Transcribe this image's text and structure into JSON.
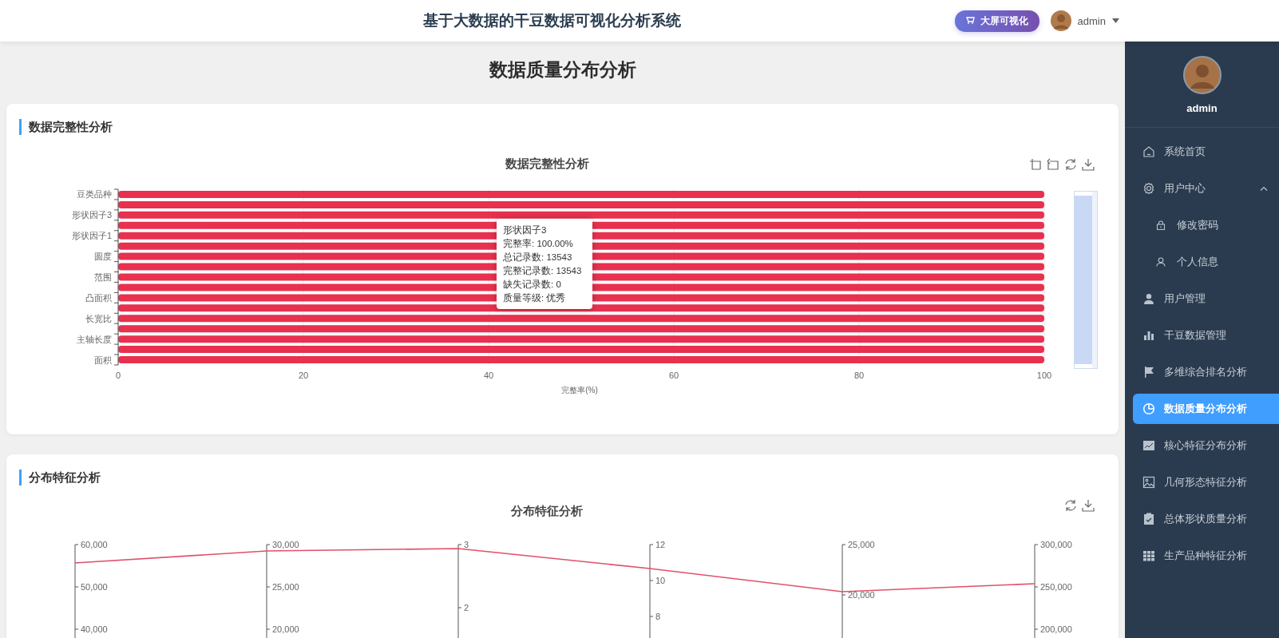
{
  "header": {
    "title": "基于大数据的干豆数据可视化分析系统",
    "screen_button": "大屏可视化",
    "user": "admin"
  },
  "page_title": "数据质量分布分析",
  "sections": [
    {
      "title": "数据完整性分析",
      "tools": [
        {
          "kind": "zoom"
        },
        {
          "kind": "zoom_back"
        },
        {
          "kind": "restore"
        },
        {
          "kind": "download"
        }
      ],
      "chart_data": {
        "type": "bar",
        "orientation": "horizontal",
        "title": "数据完整性分析",
        "xlabel": "完整率(%)",
        "grid": true,
        "categories": [
          "豆类品种",
          null,
          "形状因子3",
          null,
          "形状因子1",
          null,
          "圆度",
          null,
          "范围",
          null,
          "凸面积",
          null,
          "长宽比",
          null,
          "主轴长度",
          null,
          "面积"
        ],
        "series": [
          {
            "color": "#e8304f",
            "values": [
              100,
              100,
              100,
              100,
              100,
              100,
              100,
              100,
              100,
              100,
              100,
              100,
              100,
              100,
              100,
              100,
              100
            ]
          }
        ],
        "xlim": [
          0,
          100
        ],
        "xticks": [
          0,
          20,
          40,
          60,
          80,
          100
        ]
      },
      "zoom_slider": {
        "level": 1
      },
      "tooltip": {
        "title": "形状因子3",
        "lines": [
          "完整率: 100.00%",
          "总记录数: 13543",
          "完整记录数: 13543",
          "缺失记录数: 0",
          "质量等级: 优秀"
        ]
      }
    },
    {
      "title": "分布特征分析",
      "tools": [
        {
          "kind": "restore"
        },
        {
          "kind": "download"
        }
      ],
      "parallel_chart": {
        "title": "分布特征分析",
        "axes": [
          {
            "tick_labels": [
              "60,000",
              "50,000",
              "40,000"
            ]
          },
          {
            "tick_labels": [
              "30,000",
              "25,000",
              "20,000"
            ]
          },
          {
            "tick_labels": [
              "3",
              "2"
            ]
          },
          {
            "tick_labels": [
              "12",
              "10",
              "8"
            ]
          },
          {
            "tick_labels": [
              "25,000",
              "20,000"
            ]
          },
          {
            "tick_labels": [
              "300,000",
              "250,000",
              "200,000"
            ]
          }
        ],
        "series": [
          {
            "color": "#e0506a"
          }
        ]
      }
    }
  ],
  "sidebar": {
    "user": "admin",
    "items": [
      {
        "label": "系统首页",
        "selected": false
      },
      {
        "label": "用户中心",
        "selected": false,
        "expanded": true,
        "children": [
          {
            "label": "修改密码",
            "selected": false
          },
          {
            "label": "个人信息",
            "selected": false
          }
        ]
      },
      {
        "label": "用户管理",
        "selected": false
      },
      {
        "label": "干豆数据管理",
        "selected": false
      },
      {
        "label": "多维综合排名分析",
        "selected": false
      },
      {
        "label": "数据质量分布分析",
        "selected": true
      },
      {
        "label": "核心特征分布分析",
        "selected": false
      },
      {
        "label": "几何形态特征分析",
        "selected": false
      },
      {
        "label": "总体形状质量分析",
        "selected": false
      },
      {
        "label": "生产品种特征分析",
        "selected": false
      }
    ]
  }
}
